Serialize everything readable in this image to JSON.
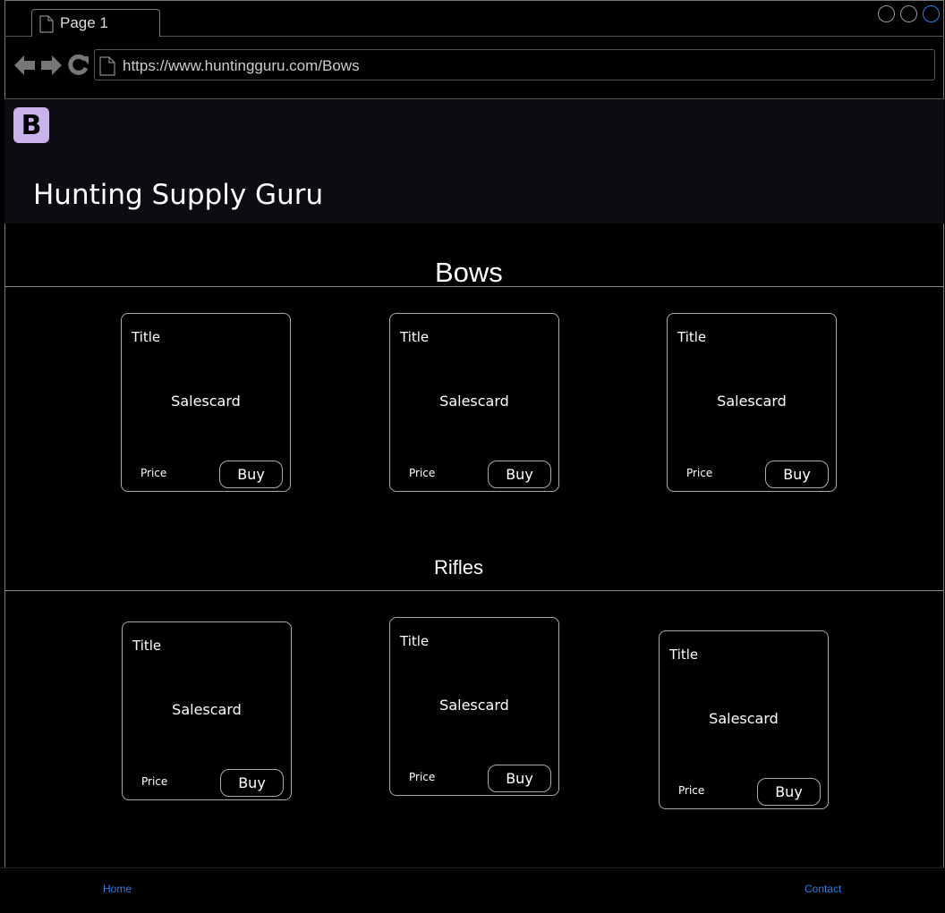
{
  "browser": {
    "tab_label": "Page 1",
    "url": "https://www.huntingguru.com/Bows"
  },
  "header": {
    "brand_letter": "B",
    "title": "Hunting Supply Guru"
  },
  "sections": [
    {
      "title": "Bows",
      "cards": [
        {
          "title": "Title",
          "body": "Salescard",
          "price": "Price",
          "buy": "Buy"
        },
        {
          "title": "Title",
          "body": "Salescard",
          "price": "Price",
          "buy": "Buy"
        },
        {
          "title": "Title",
          "body": "Salescard",
          "price": "Price",
          "buy": "Buy"
        }
      ]
    },
    {
      "title": "Rifles",
      "cards": [
        {
          "title": "Title",
          "body": "Salescard",
          "price": "Price",
          "buy": "Buy"
        },
        {
          "title": "Title",
          "body": "Salescard",
          "price": "Price",
          "buy": "Buy"
        },
        {
          "title": "Title",
          "body": "Salescard",
          "price": "Price",
          "buy": "Buy"
        }
      ]
    }
  ],
  "footer": {
    "home": "Home",
    "contact": "Contact"
  },
  "colors": {
    "brand_badge": "#c9b3ea",
    "link": "#2b7de8",
    "active_window_button": "#2b7de8"
  }
}
